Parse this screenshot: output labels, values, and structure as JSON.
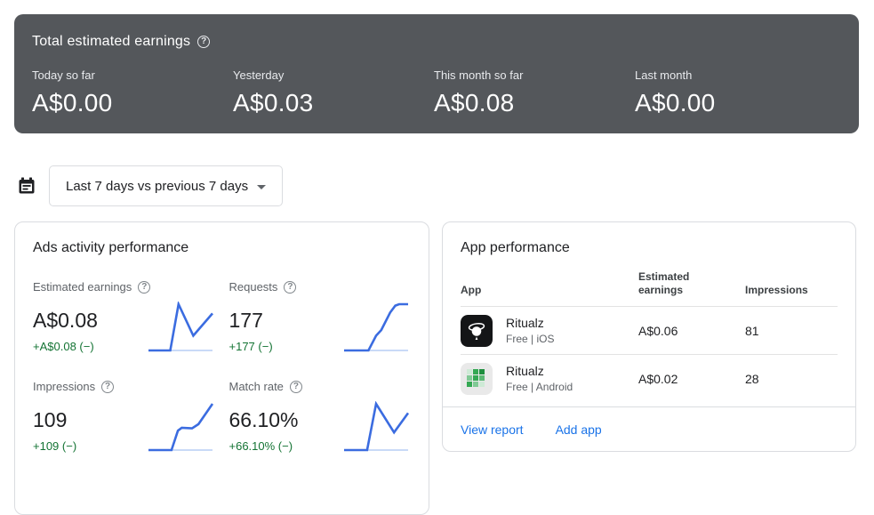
{
  "colors": {
    "dark_card_bg": "#54575b",
    "accent_blue": "#1a73e8",
    "positive_green": "#137333",
    "spark_current": "#3b6ce0",
    "spark_previous": "#c9daf7",
    "card_border": "#dadce0",
    "text_primary": "#202124",
    "text_secondary": "#5f6368"
  },
  "total_earnings": {
    "title": "Total estimated earnings",
    "help_icon": "help-circle-icon",
    "items": [
      {
        "label": "Today so far",
        "value": "A$0.00"
      },
      {
        "label": "Yesterday",
        "value": "A$0.03"
      },
      {
        "label": "This month so far",
        "value": "A$0.08"
      },
      {
        "label": "Last month",
        "value": "A$0.00"
      }
    ]
  },
  "date_filter": {
    "icon": "calendar-icon",
    "label": "Last 7 days vs previous 7 days"
  },
  "ads_activity": {
    "title": "Ads activity performance",
    "metrics": [
      {
        "label": "Estimated earnings",
        "value": "A$0.08",
        "delta": "+A$0.08 (−)"
      },
      {
        "label": "Requests",
        "value": "177",
        "delta": "+177 (−)"
      },
      {
        "label": "Impressions",
        "value": "109",
        "delta": "+109 (−)"
      },
      {
        "label": "Match rate",
        "value": "66.10%",
        "delta": "+66.10% (−)"
      }
    ]
  },
  "app_performance": {
    "title": "App performance",
    "columns": [
      "App",
      "Estimated earnings",
      "Impressions"
    ],
    "rows": [
      {
        "name": "Ritualz",
        "subtitle": "Free | iOS",
        "earnings": "A$0.06",
        "impressions": "81"
      },
      {
        "name": "Ritualz",
        "subtitle": "Free | Android",
        "earnings": "A$0.02",
        "impressions": "28"
      }
    ],
    "actions": [
      "View report",
      "Add app"
    ]
  },
  "chart_data": [
    {
      "type": "line",
      "title": "Estimated earnings — last 7 days vs previous 7 days",
      "legend": "off",
      "series": [
        {
          "name": "previous 7 days",
          "points": [
            [
              0,
              0
            ],
            [
              1,
              0
            ]
          ]
        },
        {
          "name": "last 7 days",
          "points": [
            [
              0,
              0
            ],
            [
              0.34,
              0
            ],
            [
              0.47,
              1
            ],
            [
              0.7,
              0.32
            ],
            [
              1,
              0.8
            ]
          ]
        }
      ]
    },
    {
      "type": "line",
      "title": "Requests — last 7 days vs previous 7 days",
      "legend": "off",
      "series": [
        {
          "name": "previous 7 days",
          "points": [
            [
              0,
              0
            ],
            [
              1,
              0
            ]
          ]
        },
        {
          "name": "last 7 days",
          "points": [
            [
              0,
              0
            ],
            [
              0.38,
              0
            ],
            [
              0.5,
              0.32
            ],
            [
              0.58,
              0.44
            ],
            [
              0.72,
              0.82
            ],
            [
              0.8,
              0.97
            ],
            [
              0.86,
              1
            ],
            [
              1,
              1
            ]
          ]
        }
      ]
    },
    {
      "type": "line",
      "title": "Impressions — last 7 days vs previous 7 days",
      "legend": "off",
      "series": [
        {
          "name": "previous 7 days",
          "points": [
            [
              0,
              0
            ],
            [
              1,
              0
            ]
          ]
        },
        {
          "name": "last 7 days",
          "points": [
            [
              0,
              0
            ],
            [
              0.36,
              0
            ],
            [
              0.46,
              0.42
            ],
            [
              0.52,
              0.48
            ],
            [
              0.68,
              0.47
            ],
            [
              0.78,
              0.56
            ],
            [
              1,
              1
            ]
          ]
        }
      ]
    },
    {
      "type": "line",
      "title": "Match rate — last 7 days vs previous 7 days",
      "legend": "off",
      "series": [
        {
          "name": "previous 7 days",
          "points": [
            [
              0,
              0
            ],
            [
              1,
              0
            ]
          ]
        },
        {
          "name": "last 7 days",
          "points": [
            [
              0,
              0
            ],
            [
              0.36,
              0
            ],
            [
              0.5,
              1
            ],
            [
              0.78,
              0.38
            ],
            [
              1,
              0.8
            ]
          ]
        }
      ]
    }
  ]
}
